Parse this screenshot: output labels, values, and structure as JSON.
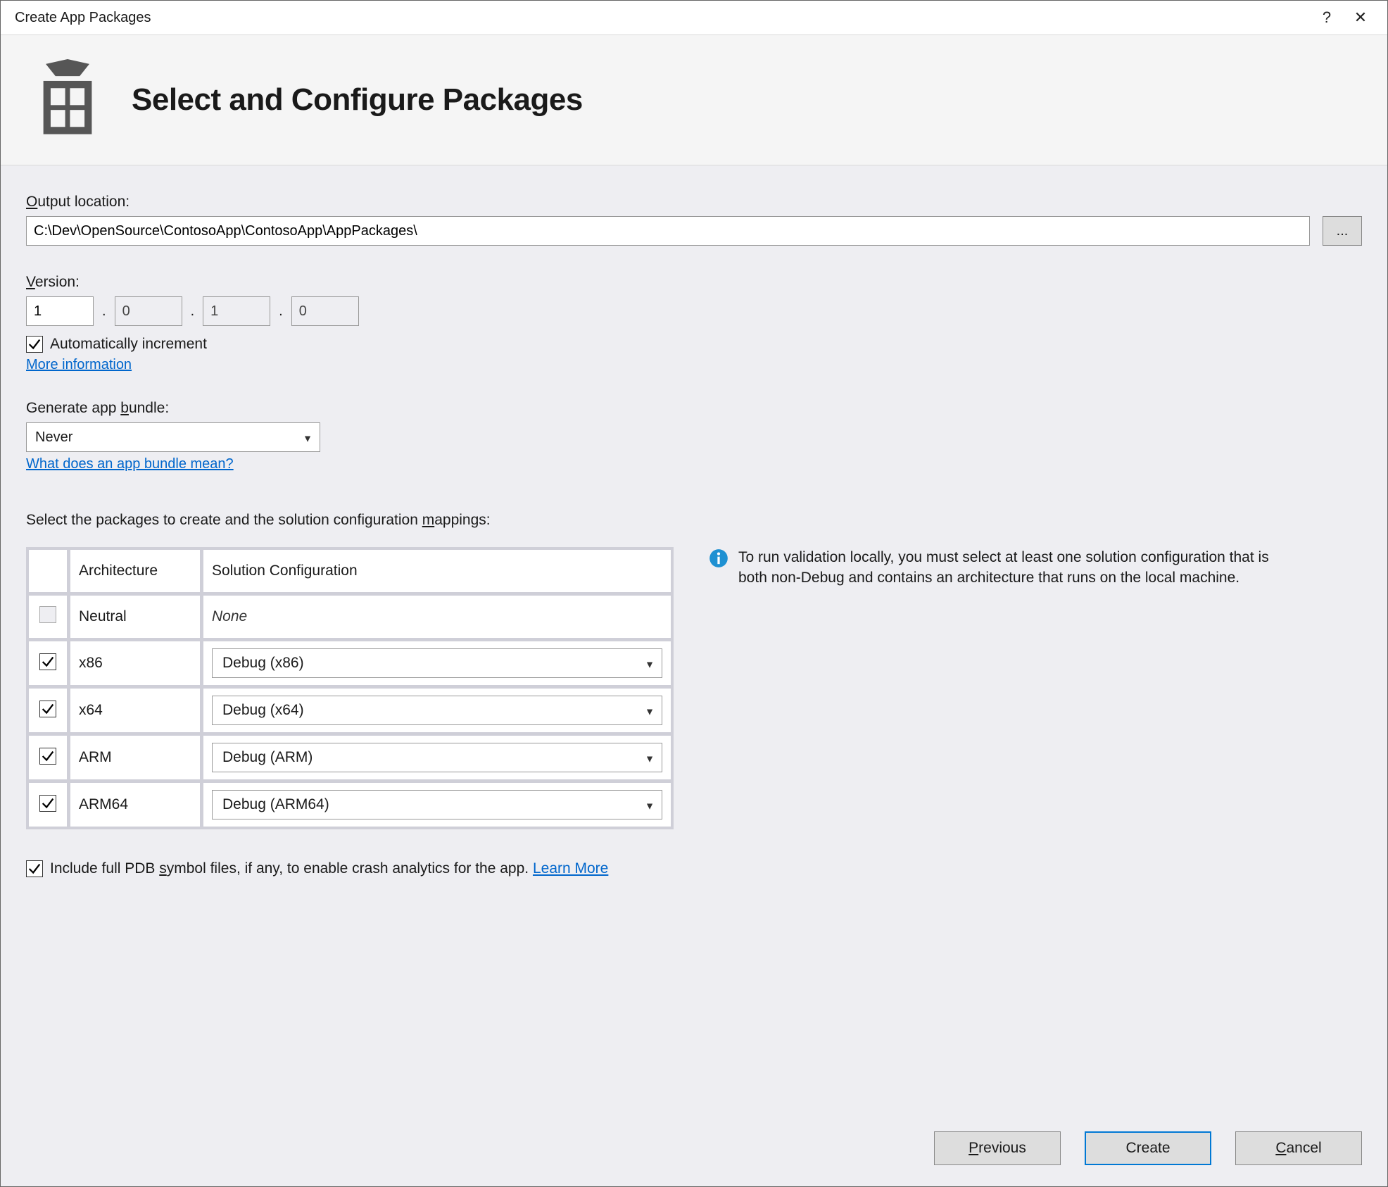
{
  "window": {
    "title": "Create App Packages",
    "help_glyph": "?",
    "close_glyph": "✕"
  },
  "header": {
    "heading": "Select and Configure Packages"
  },
  "output": {
    "label_pre": "O",
    "label_post": "utput location:",
    "value": "C:\\Dev\\OpenSource\\ContosoApp\\ContosoApp\\AppPackages\\",
    "browse_label": "..."
  },
  "version": {
    "label_pre": "V",
    "label_post": "ersion:",
    "major": "1",
    "minor": "0",
    "build": "1",
    "revision": "0",
    "auto_increment_label": "Automatically increment",
    "auto_increment_checked": true,
    "more_info": "More information"
  },
  "bundle": {
    "label_pre": "Generate app ",
    "label_u": "b",
    "label_post": "undle:",
    "value": "Never",
    "help_link": "What does an app bundle mean?"
  },
  "packages": {
    "instruction_pre": "Select the packages to create and the solution configuration ",
    "instruction_u": "m",
    "instruction_post": "appings:",
    "col_architecture": "Architecture",
    "col_solution": "Solution Configuration",
    "rows": [
      {
        "checked": false,
        "disabled": true,
        "arch": "Neutral",
        "config": "None",
        "is_none": true
      },
      {
        "checked": true,
        "disabled": false,
        "arch": "x86",
        "config": "Debug (x86)",
        "is_none": false
      },
      {
        "checked": true,
        "disabled": false,
        "arch": "x64",
        "config": "Debug (x64)",
        "is_none": false
      },
      {
        "checked": true,
        "disabled": false,
        "arch": "ARM",
        "config": "Debug (ARM)",
        "is_none": false
      },
      {
        "checked": true,
        "disabled": false,
        "arch": "ARM64",
        "config": "Debug (ARM64)",
        "is_none": false
      }
    ],
    "info_text": "To run validation locally, you must select at least one solution configuration that is both non-Debug and contains an architecture that runs on the local machine."
  },
  "pdb": {
    "checked": true,
    "label_pre": "Include full PDB ",
    "label_u": "s",
    "label_post": "ymbol files, if any, to enable crash analytics for the app. ",
    "learn_more": "Learn More"
  },
  "footer": {
    "previous_u": "P",
    "previous_rest": "revious",
    "create": "Create",
    "cancel_u": "C",
    "cancel_rest": "ancel"
  }
}
